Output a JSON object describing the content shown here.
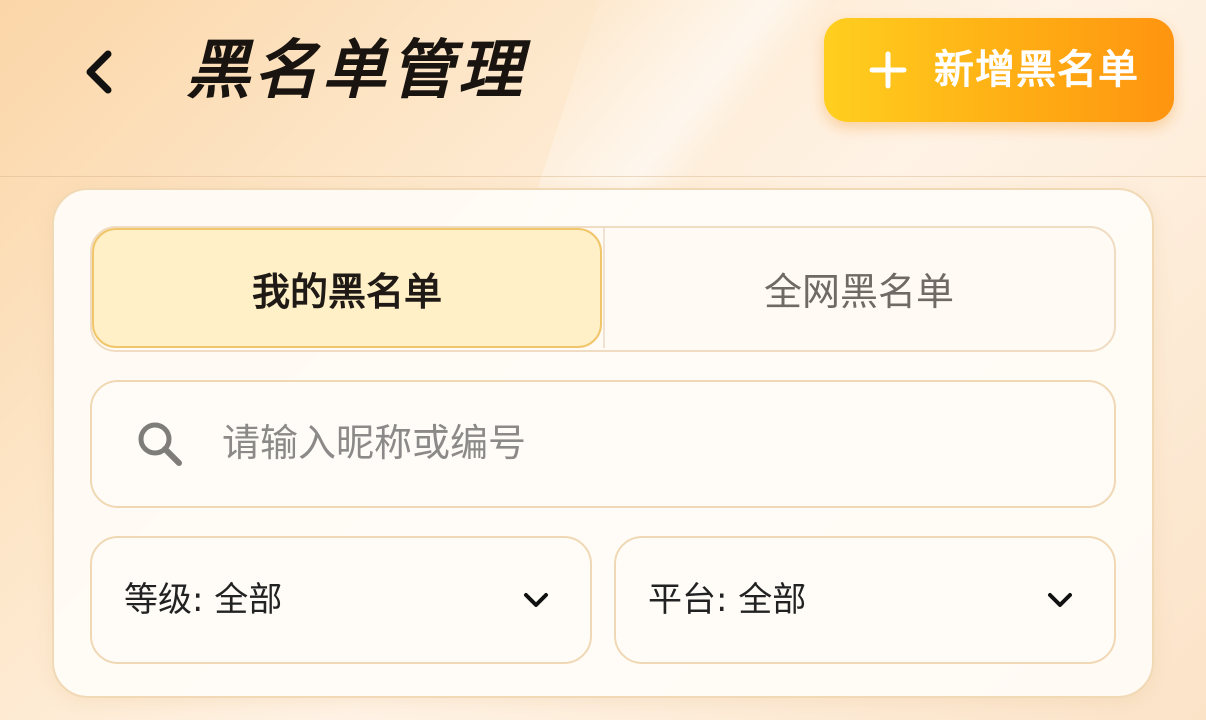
{
  "header": {
    "title": "黑名单管理",
    "back_icon": "chevron-left-icon",
    "add_button": {
      "icon": "plus-icon",
      "label": "新增黑名单"
    }
  },
  "tabs": [
    {
      "label": "我的黑名单",
      "active": true
    },
    {
      "label": "全网黑名单",
      "active": false
    }
  ],
  "search": {
    "icon": "search-icon",
    "placeholder": "请输入昵称或编号",
    "value": ""
  },
  "filters": {
    "level": {
      "label": "等级: 全部",
      "icon": "chevron-down-icon"
    },
    "platform": {
      "label": "平台: 全部",
      "icon": "chevron-down-icon"
    }
  },
  "colors": {
    "accent_start": "#ffcf1f",
    "accent_end": "#ff9410",
    "active_tab_bg": "#fff0c8",
    "active_tab_border": "#f0c66a",
    "card_border": "#f1d9b5"
  }
}
